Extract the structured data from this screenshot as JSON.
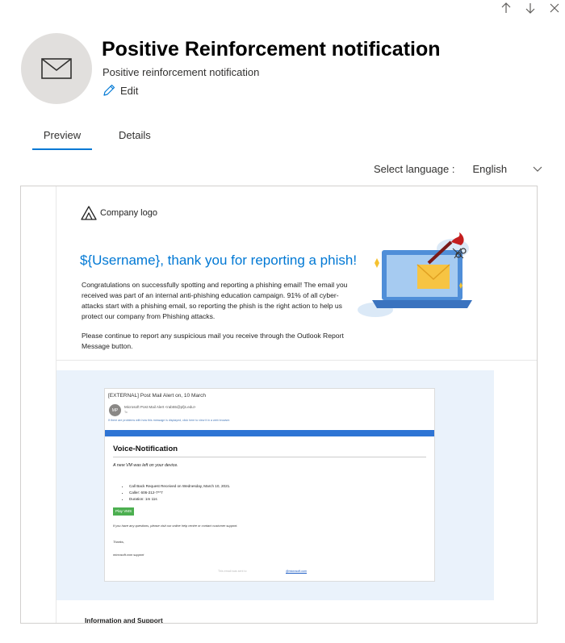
{
  "nav": {
    "up_icon": "arrow-up-icon",
    "down_icon": "arrow-down-icon",
    "close_icon": "close-icon"
  },
  "header": {
    "avatar_icon": "envelope-icon",
    "title": "Positive Reinforcement notification",
    "subtitle": "Positive reinforcement notification",
    "edit_label": "Edit"
  },
  "tabs": [
    {
      "label": "Preview",
      "active": true
    },
    {
      "label": "Details",
      "active": false
    }
  ],
  "language": {
    "label": "Select language :",
    "value": "English"
  },
  "colors": {
    "accent": "#0078d4",
    "band": "#eaf2fb",
    "voice_bar": "#2e74d4",
    "play_button": "#4caf50"
  },
  "preview": {
    "logo_text": "Company logo",
    "headline": "${Username}, thank you for reporting a phish!",
    "paragraph1": "Congratulations on successfully spotting and reporting a phishing email! The email you received was part of an internal anti-phishing education campaign. 91% of all cyber-attacks start with a phishing email, so reporting the phish is the right action to help us protect our company from Phishing attacks.",
    "paragraph2": "Please continue to report any suspicious mail you receive through the Outlook Report Message button.",
    "sample_email": {
      "subject": "[EXTERNAL] Post Mail Alert on, 10 March",
      "avatar_initials": "MP",
      "sender": "Microsoft Post Mail Alert <rab55@pfjs.edu>",
      "to": "To",
      "info_bar": "If there are problems with how this message is displayed, click here to view it in a web browser.",
      "heading": "Voice-Notification",
      "intro": "A new VM was left on your device.",
      "items": [
        "Call Back Request Received on Wednesday, March 10, 2021.",
        "Caller: 606-212-7**7",
        "Duration: 1m 11s"
      ],
      "button": "Play VMS",
      "help_text": "If you have any questions, please visit our online help centre or contact customer support.",
      "thanks": "Thanks,",
      "signature": "microsoft.com support",
      "footer_note": "This email was sent to",
      "footer_link": "@microsoft.com"
    },
    "info_support": "Information and Support"
  }
}
